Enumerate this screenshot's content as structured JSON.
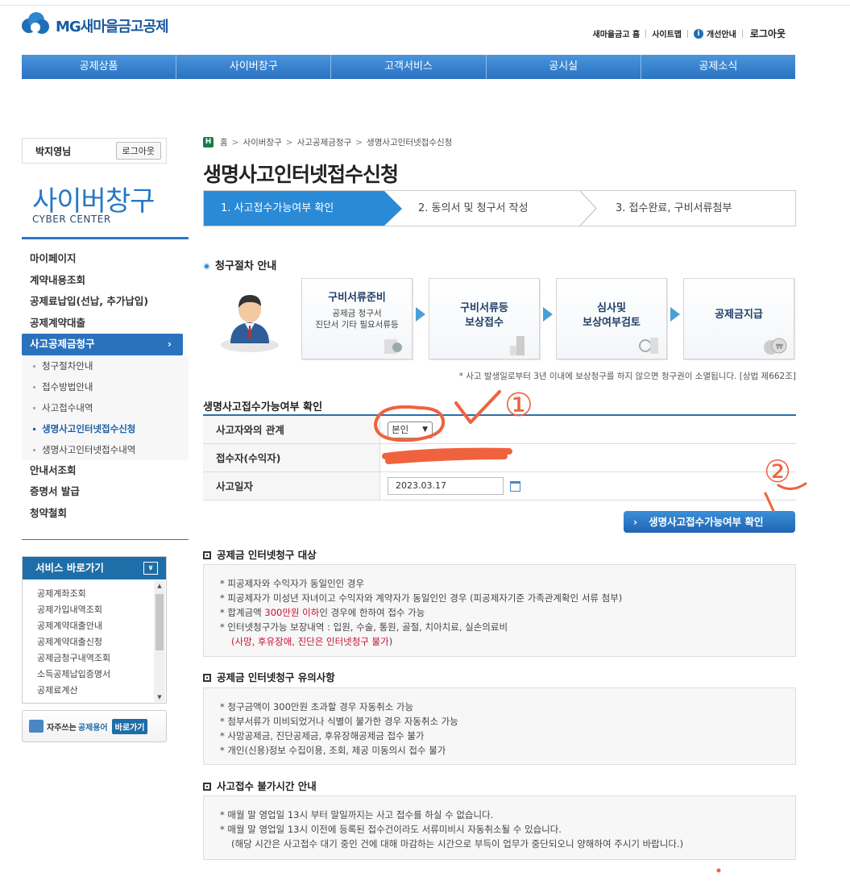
{
  "header": {
    "logo_text": "MG새마을금고공제",
    "util_links": [
      "새마을금고 홈",
      "사이트맵",
      "개선안내"
    ],
    "logout": "로그아웃",
    "nav": [
      "공제상품",
      "사이버창구",
      "고객서비스",
      "공시실",
      "공제소식"
    ]
  },
  "user": {
    "name": "박지영님",
    "logout": "로그아웃"
  },
  "side": {
    "title": "사이버창구",
    "subtitle": "CYBER CENTER",
    "menu": [
      "마이페이지",
      "계약내용조회",
      "공제료납입(선납, 추가납입)",
      "공제계약대출"
    ],
    "active": "사고공제금청구",
    "submenu": [
      "청구절차안내",
      "접수방법안내",
      "사고접수내역",
      "생명사고인터넷접수신청",
      "생명사고인터넷접수내역"
    ],
    "menu_after": [
      "안내서조회",
      "증명서 발급",
      "청약철회"
    ],
    "service": {
      "title": "서비스 바로가기",
      "items": [
        "공제계좌조회",
        "공제가입내역조회",
        "공제계약대출안내",
        "공제계약대출신청",
        "공제금청구내역조회",
        "소득공제납입증명서",
        "공제료계산"
      ]
    },
    "term": {
      "text1": "자주쓰는",
      "text2": "공제용어",
      "go": "바로가기"
    }
  },
  "breadcrumb": [
    "홈",
    "사이버창구",
    "사고공제금청구",
    "생명사고인터넷접수신청"
  ],
  "page_title": "생명사고인터넷접수신청",
  "steps": [
    "1. 사고접수가능여부 확인",
    "2. 동의서 및 청구서 작성",
    "3. 접수완료, 구비서류첨부"
  ],
  "process": {
    "title": "청구절차 안내",
    "boxes": [
      {
        "title": "구비서류준비",
        "sub1": "공제금 청구서",
        "sub2": "진단서 기타 필요서류등"
      },
      {
        "title": "구비서류등",
        "title2": "보상접수"
      },
      {
        "title": "심사및",
        "title2": "보상여부검토"
      },
      {
        "title": "공제금지급"
      }
    ],
    "notice": "* 사고 발생일로부터 3년 이내에 보상청구를 하지 않으면 청구권이 소멸됩니다. [상법 제662조]"
  },
  "form": {
    "title": "생명사고접수가능여부 확인",
    "rows": [
      {
        "label": "사고자와의 관계",
        "select_value": "본인"
      },
      {
        "label": "접수자(수익자)"
      },
      {
        "label": "사고일자",
        "date_value": "2023.03.17"
      }
    ],
    "confirm_button": "생명사고접수가능여부 확인"
  },
  "section1": {
    "title": "공제금 인터넷청구 대상",
    "lines": [
      "* 피공제자와 수익자가 동일인인 경우",
      "* 피공제자가 미성년 자녀이고 수익자와 계약자가 동일인인 경우 (피공제자기준 가족관계확인 서류 첨부)"
    ],
    "line3_pre": "* 합계금액 ",
    "line3_red": "300만원 이하",
    "line3_post": "인 경우에 한하여 접수 가능",
    "line4": "* 인터넷청구가능 보장내역 : 입원, 수술, 통원, 골절, 치아치료, 실손의료비",
    "line5_red": "(사망, 후유장애, 진단은 인터넷청구 불가",
    "line5_post": ")"
  },
  "section2": {
    "title": "공제금 인터넷청구 유의사항",
    "lines": [
      "* 청구금액이 300만원 초과할 경우 자동취소 가능",
      "* 첨부서류가 미비되었거나 식별이 불가한 경우 자동취소 가능",
      "* 사망공제금, 진단공제금, 후유장해공제금 접수 불가",
      "* 개인(신용)정보 수집이용, 조회, 제공 미동의시 접수 불가"
    ]
  },
  "section3": {
    "title": "사고접수 불가시간 안내",
    "lines": [
      "* 매월 말 영업일 13시 부터 말일까지는 사고 접수를 하실 수 없습니다.",
      "* 매월 말 영업일 13시 이전에 등록된 접수건이라도 서류미비시 자동취소될 수 있습니다.",
      "(해당 시간은 사고접수 대기 중인 건에 대해 마감하는 시간으로 부득이 업무가 중단되오니 양해하여 주시기 바랍니다.)"
    ]
  },
  "annotations": {
    "mark1": "①",
    "mark2": "②"
  },
  "colors": {
    "brand": "#2b78c4",
    "step_active": "#2b8ad6",
    "accent_red": "#c8102e",
    "annotation": "#f0623e"
  }
}
